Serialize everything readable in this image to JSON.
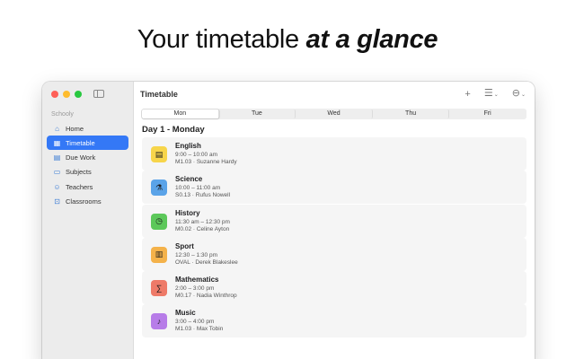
{
  "headline": {
    "plain": "Your timetable ",
    "emphasis": "at a glance"
  },
  "sidebar": {
    "heading": "Schooly",
    "items": [
      {
        "label": "Home",
        "icon": "home-icon",
        "glyph": "⌂",
        "active": false
      },
      {
        "label": "Timetable",
        "icon": "calendar-icon",
        "glyph": "▦",
        "active": true
      },
      {
        "label": "Due Work",
        "icon": "document-icon",
        "glyph": "▤",
        "active": false
      },
      {
        "label": "Subjects",
        "icon": "folder-icon",
        "glyph": "▭",
        "active": false
      },
      {
        "label": "Teachers",
        "icon": "person-icon",
        "glyph": "☺",
        "active": false
      },
      {
        "label": "Classrooms",
        "icon": "classroom-icon",
        "glyph": "⊡",
        "active": false
      }
    ]
  },
  "toolbar": {
    "title": "Timetable",
    "add_icon": "plus-icon",
    "list_icon": "list-icon",
    "more_icon": "ellipsis-circle-icon"
  },
  "segments": {
    "options": [
      "Mon",
      "Tue",
      "Wed",
      "Thu",
      "Fri"
    ],
    "selected": "Mon"
  },
  "day_heading": "Day 1 - Monday",
  "lessons": [
    {
      "subject": "English",
      "time": "9:00 – 10:00 am",
      "room": "M1.03 · Suzanne Hardy",
      "color": "#f7d54a",
      "icon": "book-icon",
      "glyph": "▤"
    },
    {
      "subject": "Science",
      "time": "10:00 – 11:00 am",
      "room": "S0.13 · Rufus Nowell",
      "color": "#5aa3e8",
      "icon": "flask-icon",
      "glyph": "⚗"
    },
    {
      "subject": "History",
      "time": "11:30 am – 12:30 pm",
      "room": "M0.02 · Celine Ayton",
      "color": "#5cc85a",
      "icon": "clock-icon",
      "glyph": "◷"
    },
    {
      "subject": "Sport",
      "time": "12:30 – 1:30 pm",
      "room": "OVAL · Derek Blakeslee",
      "color": "#f4b24a",
      "icon": "sport-icon",
      "glyph": "▥"
    },
    {
      "subject": "Mathematics",
      "time": "2:00 – 3:00 pm",
      "room": "M0.17 · Nadia Winthrop",
      "color": "#ee7a68",
      "icon": "math-icon",
      "glyph": "∑"
    },
    {
      "subject": "Music",
      "time": "3:00 – 4:00 pm",
      "room": "M1.03 · Max Tobin",
      "color": "#b77ce8",
      "icon": "music-icon",
      "glyph": "♪"
    }
  ]
}
